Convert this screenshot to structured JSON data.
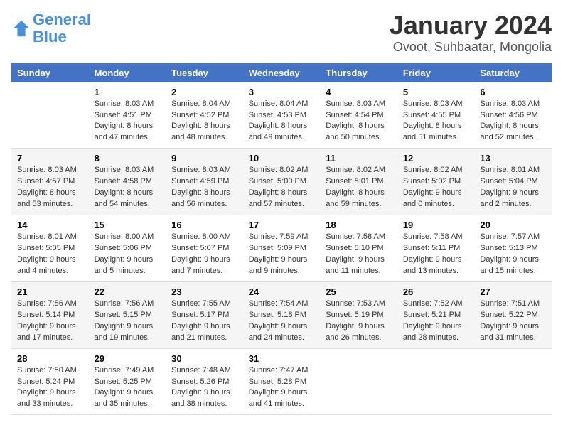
{
  "logo": {
    "general": "General",
    "blue": "Blue"
  },
  "title": "January 2024",
  "subtitle": "Ovoot, Suhbaatar, Mongolia",
  "headers": [
    "Sunday",
    "Monday",
    "Tuesday",
    "Wednesday",
    "Thursday",
    "Friday",
    "Saturday"
  ],
  "weeks": [
    [
      {
        "day": "",
        "sunrise": "",
        "sunset": "",
        "daylight": ""
      },
      {
        "day": "1",
        "sunrise": "Sunrise: 8:03 AM",
        "sunset": "Sunset: 4:51 PM",
        "daylight": "Daylight: 8 hours and 47 minutes."
      },
      {
        "day": "2",
        "sunrise": "Sunrise: 8:04 AM",
        "sunset": "Sunset: 4:52 PM",
        "daylight": "Daylight: 8 hours and 48 minutes."
      },
      {
        "day": "3",
        "sunrise": "Sunrise: 8:04 AM",
        "sunset": "Sunset: 4:53 PM",
        "daylight": "Daylight: 8 hours and 49 minutes."
      },
      {
        "day": "4",
        "sunrise": "Sunrise: 8:03 AM",
        "sunset": "Sunset: 4:54 PM",
        "daylight": "Daylight: 8 hours and 50 minutes."
      },
      {
        "day": "5",
        "sunrise": "Sunrise: 8:03 AM",
        "sunset": "Sunset: 4:55 PM",
        "daylight": "Daylight: 8 hours and 51 minutes."
      },
      {
        "day": "6",
        "sunrise": "Sunrise: 8:03 AM",
        "sunset": "Sunset: 4:56 PM",
        "daylight": "Daylight: 8 hours and 52 minutes."
      }
    ],
    [
      {
        "day": "7",
        "sunrise": "Sunrise: 8:03 AM",
        "sunset": "Sunset: 4:57 PM",
        "daylight": "Daylight: 8 hours and 53 minutes."
      },
      {
        "day": "8",
        "sunrise": "Sunrise: 8:03 AM",
        "sunset": "Sunset: 4:58 PM",
        "daylight": "Daylight: 8 hours and 54 minutes."
      },
      {
        "day": "9",
        "sunrise": "Sunrise: 8:03 AM",
        "sunset": "Sunset: 4:59 PM",
        "daylight": "Daylight: 8 hours and 56 minutes."
      },
      {
        "day": "10",
        "sunrise": "Sunrise: 8:02 AM",
        "sunset": "Sunset: 5:00 PM",
        "daylight": "Daylight: 8 hours and 57 minutes."
      },
      {
        "day": "11",
        "sunrise": "Sunrise: 8:02 AM",
        "sunset": "Sunset: 5:01 PM",
        "daylight": "Daylight: 8 hours and 59 minutes."
      },
      {
        "day": "12",
        "sunrise": "Sunrise: 8:02 AM",
        "sunset": "Sunset: 5:02 PM",
        "daylight": "Daylight: 9 hours and 0 minutes."
      },
      {
        "day": "13",
        "sunrise": "Sunrise: 8:01 AM",
        "sunset": "Sunset: 5:04 PM",
        "daylight": "Daylight: 9 hours and 2 minutes."
      }
    ],
    [
      {
        "day": "14",
        "sunrise": "Sunrise: 8:01 AM",
        "sunset": "Sunset: 5:05 PM",
        "daylight": "Daylight: 9 hours and 4 minutes."
      },
      {
        "day": "15",
        "sunrise": "Sunrise: 8:00 AM",
        "sunset": "Sunset: 5:06 PM",
        "daylight": "Daylight: 9 hours and 5 minutes."
      },
      {
        "day": "16",
        "sunrise": "Sunrise: 8:00 AM",
        "sunset": "Sunset: 5:07 PM",
        "daylight": "Daylight: 9 hours and 7 minutes."
      },
      {
        "day": "17",
        "sunrise": "Sunrise: 7:59 AM",
        "sunset": "Sunset: 5:09 PM",
        "daylight": "Daylight: 9 hours and 9 minutes."
      },
      {
        "day": "18",
        "sunrise": "Sunrise: 7:58 AM",
        "sunset": "Sunset: 5:10 PM",
        "daylight": "Daylight: 9 hours and 11 minutes."
      },
      {
        "day": "19",
        "sunrise": "Sunrise: 7:58 AM",
        "sunset": "Sunset: 5:11 PM",
        "daylight": "Daylight: 9 hours and 13 minutes."
      },
      {
        "day": "20",
        "sunrise": "Sunrise: 7:57 AM",
        "sunset": "Sunset: 5:13 PM",
        "daylight": "Daylight: 9 hours and 15 minutes."
      }
    ],
    [
      {
        "day": "21",
        "sunrise": "Sunrise: 7:56 AM",
        "sunset": "Sunset: 5:14 PM",
        "daylight": "Daylight: 9 hours and 17 minutes."
      },
      {
        "day": "22",
        "sunrise": "Sunrise: 7:56 AM",
        "sunset": "Sunset: 5:15 PM",
        "daylight": "Daylight: 9 hours and 19 minutes."
      },
      {
        "day": "23",
        "sunrise": "Sunrise: 7:55 AM",
        "sunset": "Sunset: 5:17 PM",
        "daylight": "Daylight: 9 hours and 21 minutes."
      },
      {
        "day": "24",
        "sunrise": "Sunrise: 7:54 AM",
        "sunset": "Sunset: 5:18 PM",
        "daylight": "Daylight: 9 hours and 24 minutes."
      },
      {
        "day": "25",
        "sunrise": "Sunrise: 7:53 AM",
        "sunset": "Sunset: 5:19 PM",
        "daylight": "Daylight: 9 hours and 26 minutes."
      },
      {
        "day": "26",
        "sunrise": "Sunrise: 7:52 AM",
        "sunset": "Sunset: 5:21 PM",
        "daylight": "Daylight: 9 hours and 28 minutes."
      },
      {
        "day": "27",
        "sunrise": "Sunrise: 7:51 AM",
        "sunset": "Sunset: 5:22 PM",
        "daylight": "Daylight: 9 hours and 31 minutes."
      }
    ],
    [
      {
        "day": "28",
        "sunrise": "Sunrise: 7:50 AM",
        "sunset": "Sunset: 5:24 PM",
        "daylight": "Daylight: 9 hours and 33 minutes."
      },
      {
        "day": "29",
        "sunrise": "Sunrise: 7:49 AM",
        "sunset": "Sunset: 5:25 PM",
        "daylight": "Daylight: 9 hours and 35 minutes."
      },
      {
        "day": "30",
        "sunrise": "Sunrise: 7:48 AM",
        "sunset": "Sunset: 5:26 PM",
        "daylight": "Daylight: 9 hours and 38 minutes."
      },
      {
        "day": "31",
        "sunrise": "Sunrise: 7:47 AM",
        "sunset": "Sunset: 5:28 PM",
        "daylight": "Daylight: 9 hours and 41 minutes."
      },
      {
        "day": "",
        "sunrise": "",
        "sunset": "",
        "daylight": ""
      },
      {
        "day": "",
        "sunrise": "",
        "sunset": "",
        "daylight": ""
      },
      {
        "day": "",
        "sunrise": "",
        "sunset": "",
        "daylight": ""
      }
    ]
  ]
}
